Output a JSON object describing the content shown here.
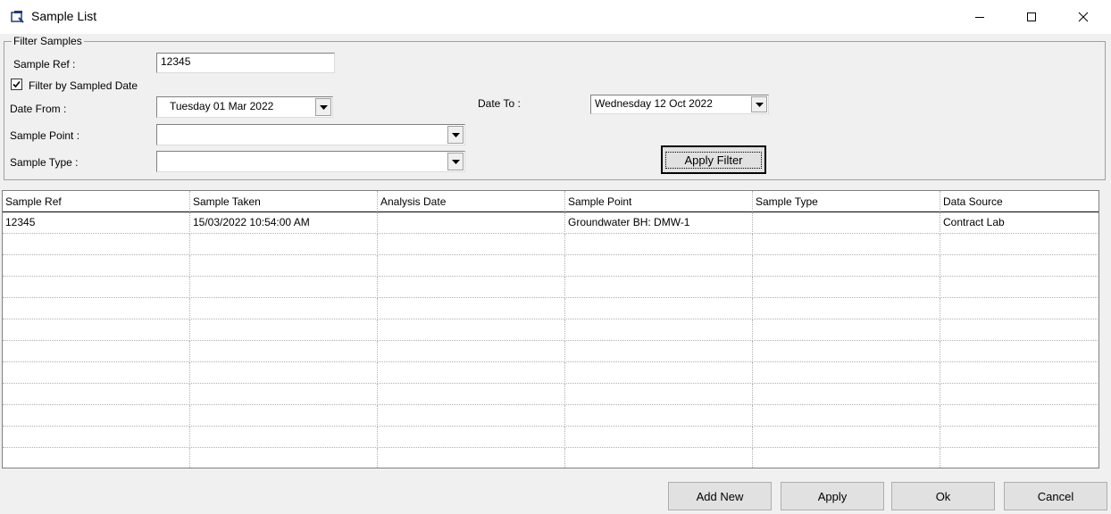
{
  "window": {
    "title": "Sample List"
  },
  "filter": {
    "group_label": "Filter Samples",
    "sample_ref_label": "Sample Ref :",
    "sample_ref_value": "12345",
    "filter_by_date_label": "Filter by Sampled Date",
    "filter_by_date_checked": true,
    "date_from_label": "Date From :",
    "date_from_value": "Tuesday   01 Mar 2022",
    "date_to_label": "Date To :",
    "date_to_value": "Wednesday 12 Oct  2022",
    "sample_point_label": "Sample Point :",
    "sample_point_value": "",
    "sample_type_label": "Sample Type :",
    "sample_type_value": "",
    "apply_filter_label": "Apply Filter"
  },
  "grid": {
    "columns": [
      "Sample Ref",
      "Sample Taken",
      "Analysis Date",
      "Sample Point",
      "Sample Type",
      "Data Source"
    ],
    "rows": [
      [
        "12345",
        "15/03/2022 10:54:00 AM",
        "",
        "Groundwater BH: DMW-1",
        "",
        "Contract Lab"
      ],
      [
        "",
        "",
        "",
        "",
        "",
        ""
      ],
      [
        "",
        "",
        "",
        "",
        "",
        ""
      ],
      [
        "",
        "",
        "",
        "",
        "",
        ""
      ],
      [
        "",
        "",
        "",
        "",
        "",
        ""
      ],
      [
        "",
        "",
        "",
        "",
        "",
        ""
      ],
      [
        "",
        "",
        "",
        "",
        "",
        ""
      ],
      [
        "",
        "",
        "",
        "",
        "",
        ""
      ],
      [
        "",
        "",
        "",
        "",
        "",
        ""
      ],
      [
        "",
        "",
        "",
        "",
        "",
        ""
      ],
      [
        "",
        "",
        "",
        "",
        "",
        ""
      ],
      [
        "",
        "",
        "",
        "",
        "",
        ""
      ]
    ]
  },
  "footer": {
    "add_new_label": "Add New",
    "apply_label": "Apply",
    "ok_label": "Ok",
    "cancel_label": "Cancel"
  }
}
